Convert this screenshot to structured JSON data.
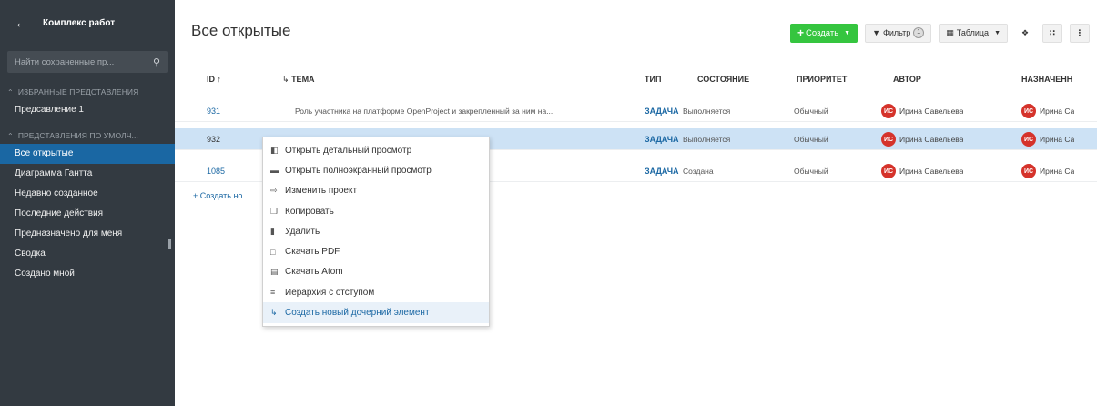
{
  "sidebar": {
    "back_title": "Комплекс работ",
    "search_placeholder": "Найти сохраненные пр...",
    "favorites_section": "Избранные представления",
    "favorites": [
      "Предсавление 1"
    ],
    "defaults_section": "Представления по умолч...",
    "defaults": [
      "Все открытые",
      "Диаграмма Гантта",
      "Недавно созданное",
      "Последние действия",
      "Предназначено для меня",
      "Сводка",
      "Создано мной"
    ]
  },
  "header": {
    "title": "Все открытые",
    "create_label": "Создать",
    "filter_label": "Фильтр",
    "filter_count": "1",
    "view_label": "Таблица"
  },
  "table": {
    "columns": [
      "ID",
      "Тема",
      "Тип",
      "Состояние",
      "Приоритет",
      "Автор",
      "Назначенн"
    ],
    "rows": [
      {
        "id": "931",
        "subject": "Роль участника на платформе OpenProject и закрепленный за ним на...",
        "type": "Задача",
        "status": "Выполняется",
        "priority": "Обычный",
        "author_initials": "ИС",
        "author": "Ирина Савельева",
        "assignee_initials": "ИС",
        "assignee": "Ирина Са"
      },
      {
        "id": "932",
        "subject": "",
        "type": "Задача",
        "status": "Выполняется",
        "priority": "Обычный",
        "author_initials": "ИС",
        "author": "Ирина Савельева",
        "assignee_initials": "ИС",
        "assignee": "Ирина Са"
      },
      {
        "id": "1085",
        "subject": "",
        "type": "Задача",
        "status": "Создана",
        "priority": "Обычный",
        "author_initials": "ИС",
        "author": "Ирина Савельева",
        "assignee_initials": "ИС",
        "assignee": "Ирина Са"
      }
    ],
    "create_new_label": "+ Создать но"
  },
  "context_menu": {
    "items": [
      "Открыть детальный просмотр",
      "Открыть полноэкранный просмотр",
      "Изменить проект",
      "Копировать",
      "Удалить",
      "Скачать PDF",
      "Скачать Atom",
      "Иерархия с отступом",
      "Создать новый дочерний элемент"
    ]
  },
  "colors": {
    "sidebar_bg": "#333a41",
    "accent": "#1a67a3",
    "create_button": "#35c53f",
    "avatar": "#d5332b",
    "selected_row": "#cde2f5"
  }
}
